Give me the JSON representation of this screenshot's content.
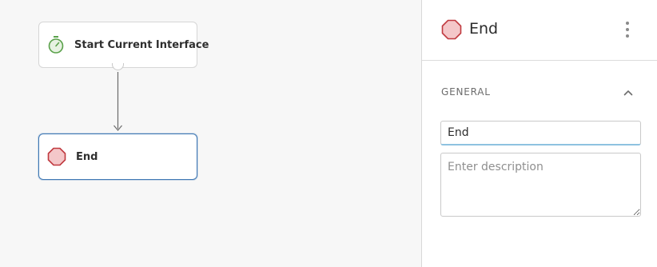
{
  "canvas": {
    "nodes": [
      {
        "label": "Start Current Interface",
        "icon": "stopwatch-icon"
      },
      {
        "label": "End",
        "icon": "stop-octagon-icon"
      }
    ]
  },
  "panel": {
    "title": "End",
    "title_icon": "stop-octagon-icon",
    "menu_icon": "more-vertical-icon",
    "section": {
      "title": "GENERAL",
      "collapse_icon": "chevron-up-icon"
    },
    "name_value": "End",
    "description_placeholder": "Enter description",
    "description_value": ""
  },
  "colors": {
    "start_icon": "#5aa14a",
    "end_icon_fill": "#f4c7c9",
    "end_icon_stroke": "#c0393f",
    "selected_border": "#3f78b4",
    "input_focus": "#8ec2e0"
  }
}
